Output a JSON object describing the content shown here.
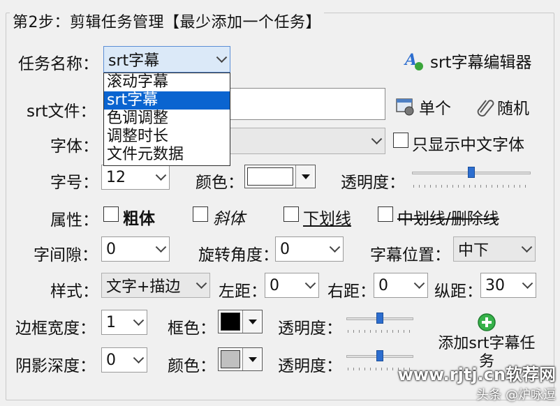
{
  "group": {
    "title": "第2步：剪辑任务管理【最少添加一个任务】"
  },
  "task": {
    "label": "任务名称：",
    "selected": "srt字幕",
    "options": [
      "滚动字幕",
      "srt字幕",
      "色调调整",
      "调整时长",
      "文件元数据"
    ],
    "editor_button": "srt字幕编辑器"
  },
  "srt": {
    "label": "srt文件：",
    "single_button": "单个",
    "random_button": "随机"
  },
  "font": {
    "label": "字体：",
    "only_chinese": "只显示中文字体"
  },
  "size": {
    "label": "字号：",
    "value": "12",
    "color_label": "颜色：",
    "opacity_label": "透明度：",
    "opacity": 0.5,
    "color": "#ffffff"
  },
  "attr": {
    "label": "属性：",
    "bold": "粗体",
    "italic": "斜体",
    "underline": "下划线",
    "strike": "中划线/删除线"
  },
  "spacing": {
    "label": "字间隙：",
    "value": "0",
    "rotate_label": "旋转角度：",
    "rotate_value": "0",
    "pos_label": "字幕位置：",
    "pos_value": "中下"
  },
  "style": {
    "label": "样式：",
    "value": "文字+描边",
    "left_label": "左距：",
    "left_value": "0",
    "right_label": "右距：",
    "right_value": "0",
    "vert_label": "纵距：",
    "vert_value": "30"
  },
  "border": {
    "label": "边框宽度：",
    "value": "1",
    "color_label": "框色：",
    "opacity_label": "透明度：",
    "opacity": 0.5,
    "color": "#000000"
  },
  "shadow": {
    "label": "阴影深度：",
    "value": "0",
    "color_label": "颜色：",
    "opacity_label": "透明度：",
    "opacity": 0.5,
    "color": "#c0c0c0"
  },
  "add_button": {
    "label": "添加srt字幕任务"
  },
  "watermark": {
    "site": "www.rjtj.cn软荐网",
    "author": "头条 @炉咏逗"
  }
}
